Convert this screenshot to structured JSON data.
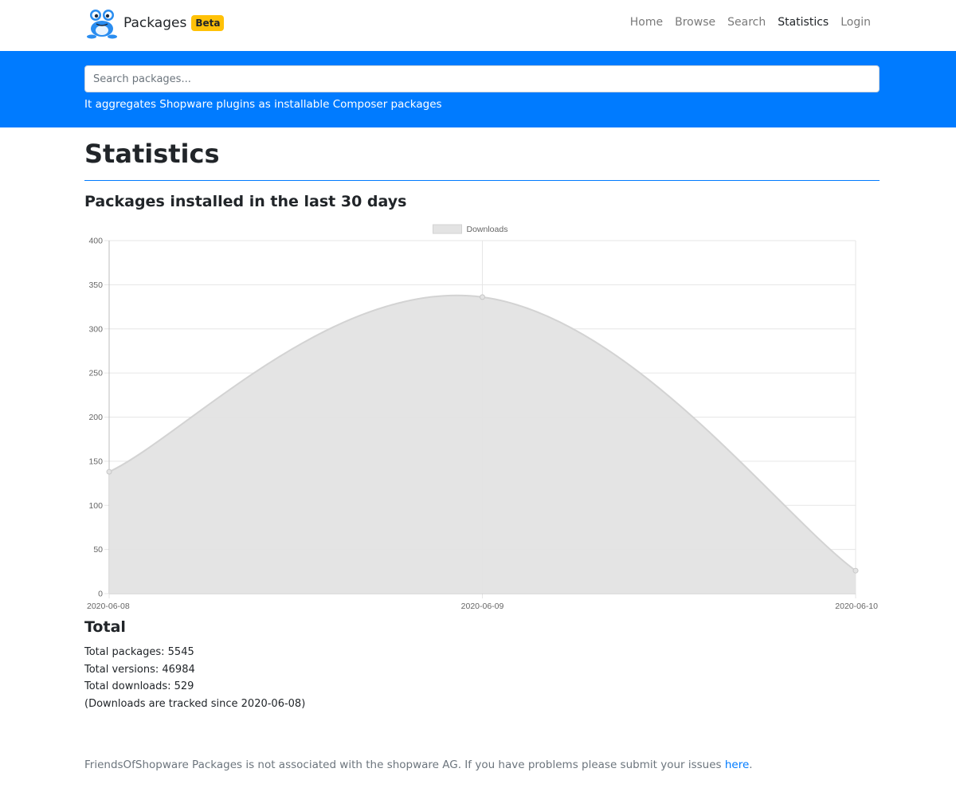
{
  "navbar": {
    "brand_text": "Packages",
    "badge": "Beta",
    "links": [
      {
        "label": "Home"
      },
      {
        "label": "Browse"
      },
      {
        "label": "Search"
      },
      {
        "label": "Statistics",
        "active": true
      },
      {
        "label": "Login"
      }
    ]
  },
  "hero": {
    "search_placeholder": "Search packages...",
    "tagline": "It aggregates Shopware plugins as installable Composer packages"
  },
  "main": {
    "title": "Statistics",
    "chart_heading": "Packages installed in the last 30 days",
    "total_heading": "Total",
    "stats": [
      "Total packages: 5545",
      "Total versions: 46984",
      "Total downloads: 529",
      "(Downloads are tracked since 2020-06-08)"
    ]
  },
  "chart_data": {
    "type": "area",
    "x": [
      "2020-06-08",
      "2020-06-09",
      "2020-06-10"
    ],
    "series": [
      {
        "name": "Downloads",
        "values": [
          138,
          336,
          26
        ]
      }
    ],
    "ylim": [
      0,
      400
    ],
    "yticks": [
      0,
      50,
      100,
      150,
      200,
      250,
      300,
      350,
      400
    ],
    "legend": "top-center",
    "grid": true,
    "colors": {
      "fill": "#e3e3e3",
      "stroke": "#d3d3d3",
      "grid": "#e6e6e6"
    }
  },
  "footer": {
    "text": "FriendsOfShopware Packages is not associated with the shopware AG. If you have problems please submit your issues ",
    "link_label": "here",
    "suffix": "."
  }
}
